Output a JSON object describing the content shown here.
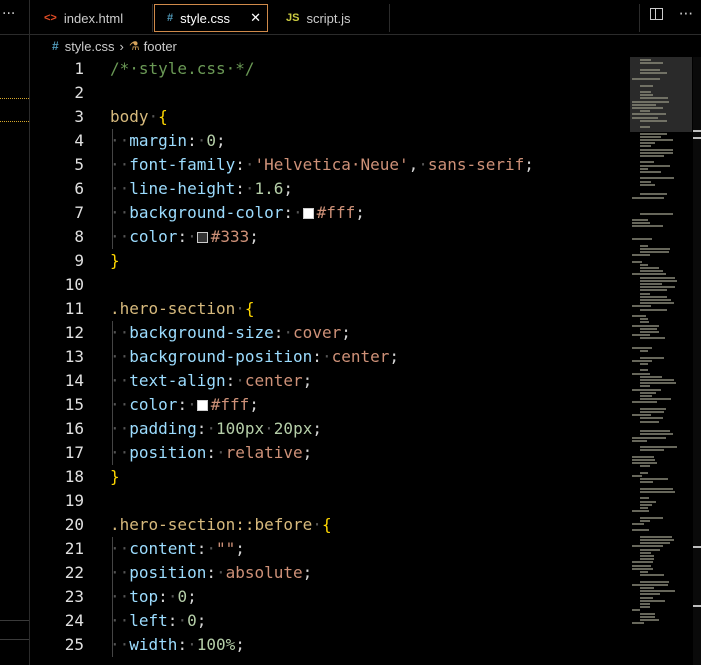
{
  "sidebar": {
    "more_label": "···"
  },
  "tabs": [
    {
      "label": "index.html",
      "icon": "<>",
      "icon_color": "#e44d26"
    },
    {
      "label": "style.css",
      "icon": "#",
      "icon_color": "#519aba",
      "close": "✕"
    },
    {
      "label": "script.js",
      "icon": "JS",
      "icon_color": "#cbcb41"
    }
  ],
  "tab_actions": {
    "more": "···"
  },
  "breadcrumb": {
    "file": "style.css",
    "symbol": "footer"
  },
  "code_lines": [
    [
      {
        "t": "/*·style.css·*/",
        "c": "c-comment"
      }
    ],
    [],
    [
      {
        "t": "body",
        "c": "c-sel"
      },
      {
        "t": "·",
        "c": "ws"
      },
      {
        "t": "{",
        "c": "c-brace"
      }
    ],
    [
      {
        "t": "··",
        "c": "ws"
      },
      {
        "t": "margin",
        "c": "c-prop"
      },
      {
        "t": ":",
        "c": "c-punc"
      },
      {
        "t": "·",
        "c": "ws"
      },
      {
        "t": "0",
        "c": "c-num"
      },
      {
        "t": ";",
        "c": "c-punc"
      }
    ],
    [
      {
        "t": "··",
        "c": "ws"
      },
      {
        "t": "font-family",
        "c": "c-prop"
      },
      {
        "t": ":",
        "c": "c-punc"
      },
      {
        "t": "·",
        "c": "ws"
      },
      {
        "t": "'Helvetica·Neue'",
        "c": "c-str"
      },
      {
        "t": ",",
        "c": "c-punc"
      },
      {
        "t": "·",
        "c": "ws"
      },
      {
        "t": "sans-serif",
        "c": "c-str"
      },
      {
        "t": ";",
        "c": "c-punc"
      }
    ],
    [
      {
        "t": "··",
        "c": "ws"
      },
      {
        "t": "line-height",
        "c": "c-prop"
      },
      {
        "t": ":",
        "c": "c-punc"
      },
      {
        "t": "·",
        "c": "ws"
      },
      {
        "t": "1.6",
        "c": "c-num"
      },
      {
        "t": ";",
        "c": "c-punc"
      }
    ],
    [
      {
        "t": "··",
        "c": "ws"
      },
      {
        "t": "background-color",
        "c": "c-prop"
      },
      {
        "t": ":",
        "c": "c-punc"
      },
      {
        "t": "·",
        "c": "ws"
      },
      {
        "swatch": "#ffffff"
      },
      {
        "t": "#fff",
        "c": "c-str"
      },
      {
        "t": ";",
        "c": "c-punc"
      }
    ],
    [
      {
        "t": "··",
        "c": "ws"
      },
      {
        "t": "color",
        "c": "c-prop"
      },
      {
        "t": ":",
        "c": "c-punc"
      },
      {
        "t": "·",
        "c": "ws"
      },
      {
        "swatch": "#333333"
      },
      {
        "t": "#333",
        "c": "c-str"
      },
      {
        "t": ";",
        "c": "c-punc"
      }
    ],
    [
      {
        "t": "}",
        "c": "c-brace"
      }
    ],
    [],
    [
      {
        "t": ".hero-section",
        "c": "c-sel"
      },
      {
        "t": "·",
        "c": "ws"
      },
      {
        "t": "{",
        "c": "c-brace"
      }
    ],
    [
      {
        "t": "··",
        "c": "ws"
      },
      {
        "t": "background-size",
        "c": "c-prop"
      },
      {
        "t": ":",
        "c": "c-punc"
      },
      {
        "t": "·",
        "c": "ws"
      },
      {
        "t": "cover",
        "c": "c-str"
      },
      {
        "t": ";",
        "c": "c-punc"
      }
    ],
    [
      {
        "t": "··",
        "c": "ws"
      },
      {
        "t": "background-position",
        "c": "c-prop"
      },
      {
        "t": ":",
        "c": "c-punc"
      },
      {
        "t": "·",
        "c": "ws"
      },
      {
        "t": "center",
        "c": "c-str"
      },
      {
        "t": ";",
        "c": "c-punc"
      }
    ],
    [
      {
        "t": "··",
        "c": "ws"
      },
      {
        "t": "text-align",
        "c": "c-prop"
      },
      {
        "t": ":",
        "c": "c-punc"
      },
      {
        "t": "·",
        "c": "ws"
      },
      {
        "t": "center",
        "c": "c-str"
      },
      {
        "t": ";",
        "c": "c-punc"
      }
    ],
    [
      {
        "t": "··",
        "c": "ws"
      },
      {
        "t": "color",
        "c": "c-prop"
      },
      {
        "t": ":",
        "c": "c-punc"
      },
      {
        "t": "·",
        "c": "ws"
      },
      {
        "swatch": "#ffffff"
      },
      {
        "t": "#fff",
        "c": "c-str"
      },
      {
        "t": ";",
        "c": "c-punc"
      }
    ],
    [
      {
        "t": "··",
        "c": "ws"
      },
      {
        "t": "padding",
        "c": "c-prop"
      },
      {
        "t": ":",
        "c": "c-punc"
      },
      {
        "t": "·",
        "c": "ws"
      },
      {
        "t": "100px",
        "c": "c-num"
      },
      {
        "t": "·",
        "c": "ws"
      },
      {
        "t": "20px",
        "c": "c-num"
      },
      {
        "t": ";",
        "c": "c-punc"
      }
    ],
    [
      {
        "t": "··",
        "c": "ws"
      },
      {
        "t": "position",
        "c": "c-prop"
      },
      {
        "t": ":",
        "c": "c-punc"
      },
      {
        "t": "·",
        "c": "ws"
      },
      {
        "t": "relative",
        "c": "c-str"
      },
      {
        "t": ";",
        "c": "c-punc"
      }
    ],
    [
      {
        "t": "}",
        "c": "c-brace"
      }
    ],
    [],
    [
      {
        "t": ".hero-section::before",
        "c": "c-sel"
      },
      {
        "t": "·",
        "c": "ws"
      },
      {
        "t": "{",
        "c": "c-brace"
      }
    ],
    [
      {
        "t": "··",
        "c": "ws"
      },
      {
        "t": "content",
        "c": "c-prop"
      },
      {
        "t": ":",
        "c": "c-punc"
      },
      {
        "t": "·",
        "c": "ws"
      },
      {
        "t": "\"\"",
        "c": "c-str"
      },
      {
        "t": ";",
        "c": "c-punc"
      }
    ],
    [
      {
        "t": "··",
        "c": "ws"
      },
      {
        "t": "position",
        "c": "c-prop"
      },
      {
        "t": ":",
        "c": "c-punc"
      },
      {
        "t": "·",
        "c": "ws"
      },
      {
        "t": "absolute",
        "c": "c-str"
      },
      {
        "t": ";",
        "c": "c-punc"
      }
    ],
    [
      {
        "t": "··",
        "c": "ws"
      },
      {
        "t": "top",
        "c": "c-prop"
      },
      {
        "t": ":",
        "c": "c-punc"
      },
      {
        "t": "·",
        "c": "ws"
      },
      {
        "t": "0",
        "c": "c-num"
      },
      {
        "t": ";",
        "c": "c-punc"
      }
    ],
    [
      {
        "t": "··",
        "c": "ws"
      },
      {
        "t": "left",
        "c": "c-prop"
      },
      {
        "t": ":",
        "c": "c-punc"
      },
      {
        "t": "·",
        "c": "ws"
      },
      {
        "t": "0",
        "c": "c-num"
      },
      {
        "t": ";",
        "c": "c-punc"
      }
    ],
    [
      {
        "t": "··",
        "c": "ws"
      },
      {
        "t": "width",
        "c": "c-prop"
      },
      {
        "t": ":",
        "c": "c-punc"
      },
      {
        "t": "·",
        "c": "ws"
      },
      {
        "t": "100%",
        "c": "c-num"
      },
      {
        "t": ";",
        "c": "c-punc"
      }
    ]
  ],
  "indented_lines": [
    4,
    5,
    6,
    7,
    8,
    12,
    13,
    14,
    15,
    16,
    17,
    21,
    22,
    23,
    24,
    25
  ]
}
